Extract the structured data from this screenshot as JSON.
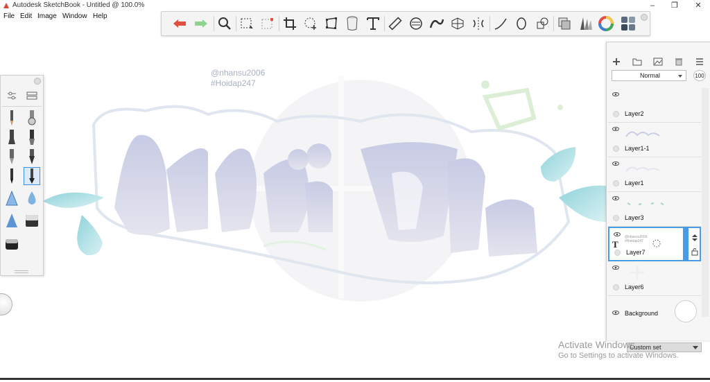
{
  "window": {
    "title": "Autodesk SketchBook - Untitled @ 100.0%",
    "minimize": "–",
    "maximize": "❐",
    "close": "✕"
  },
  "menu": {
    "items": [
      "File",
      "Edit",
      "Image",
      "Window",
      "Help"
    ]
  },
  "toolbar": {
    "tools": [
      "undo-icon",
      "redo-icon",
      "zoom-icon",
      "select-rect-icon",
      "transform-select-icon",
      "crop-icon",
      "lasso-move-icon",
      "distort-icon",
      "bucket-icon",
      "text-icon",
      "ruler-icon",
      "ellipse-guide-icon",
      "curve-icon",
      "perspective-icon",
      "symmetry-icon",
      "stroke-icon",
      "shape-icon",
      "layer-copy-icon",
      "copic-icon",
      "brush-library-icon",
      "color-wheel-icon",
      "palette-icon"
    ]
  },
  "canvas": {
    "watermark_line1": "@nhansu2006",
    "watermark_line2": "#Hoidap247"
  },
  "layers": {
    "blend_mode": "Normal",
    "opacity": "100",
    "items": [
      {
        "name": "Layer2",
        "selected": false
      },
      {
        "name": "Layer1-1",
        "selected": false
      },
      {
        "name": "Layer1",
        "selected": false
      },
      {
        "name": "Layer3",
        "selected": false
      },
      {
        "name": "Layer7",
        "selected": true
      },
      {
        "name": "Layer6",
        "selected": false
      },
      {
        "name": "Background",
        "selected": false
      }
    ],
    "layer7_thumb_line1": "@nhansu2006",
    "layer7_thumb_line2": "#Hoidap247"
  },
  "brush_palette": {
    "set_name": "Custom set"
  },
  "os_overlay": {
    "line1": "Activate Windows",
    "line2": "Go to Settings to activate Windows."
  },
  "colors": {
    "accent": "#4a9be6",
    "undo": "#e05040",
    "redo": "#8fd28f",
    "panel_bg": "#f4f4f4"
  }
}
